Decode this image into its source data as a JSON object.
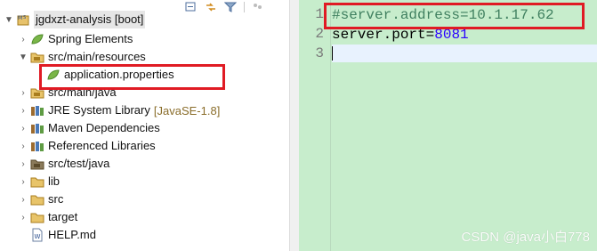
{
  "explorer": {
    "tree": [
      {
        "label": "jgdxzt-analysis [boot]",
        "icon": "maven-project-icon",
        "expanded": true,
        "level": 0
      },
      {
        "label": "Spring Elements",
        "icon": "spring-leaf-icon",
        "expanded": false,
        "level": 1
      },
      {
        "label": "src/main/resources",
        "icon": "source-folder-icon",
        "expanded": true,
        "level": 1
      },
      {
        "label": "application.properties",
        "icon": "spring-properties-icon",
        "level": 2
      },
      {
        "label": "src/main/java",
        "icon": "source-folder-icon",
        "expanded": false,
        "level": 1
      },
      {
        "label": "JRE System Library",
        "decorator": "[JavaSE-1.8]",
        "icon": "library-icon",
        "expanded": false,
        "level": 1
      },
      {
        "label": "Maven Dependencies",
        "icon": "library-icon",
        "expanded": false,
        "level": 1
      },
      {
        "label": "Referenced Libraries",
        "icon": "library-icon",
        "expanded": false,
        "level": 1
      },
      {
        "label": "src/test/java",
        "icon": "source-folder-icon",
        "expanded": false,
        "level": 1
      },
      {
        "label": "lib",
        "icon": "folder-icon",
        "expanded": false,
        "level": 1
      },
      {
        "label": "src",
        "icon": "folder-icon",
        "expanded": false,
        "level": 1
      },
      {
        "label": "target",
        "icon": "folder-icon",
        "expanded": false,
        "level": 1
      },
      {
        "label": "HELP.md",
        "icon": "markdown-file-icon",
        "level": 1
      }
    ]
  },
  "editor": {
    "lines": [
      {
        "number": "1",
        "text": "#server.address=10.1.17.62",
        "type": "comment"
      },
      {
        "number": "2",
        "key": "server.port",
        "eq": "=",
        "value": "8081",
        "type": "property"
      },
      {
        "number": "3",
        "text": "",
        "type": "current"
      }
    ]
  },
  "watermark": "CSDN @java小白778",
  "colors": {
    "editor_bg": "#c7edcc",
    "highlight_border": "#e01b24",
    "comment": "#3f7f5f",
    "value": "#2a00ff"
  }
}
